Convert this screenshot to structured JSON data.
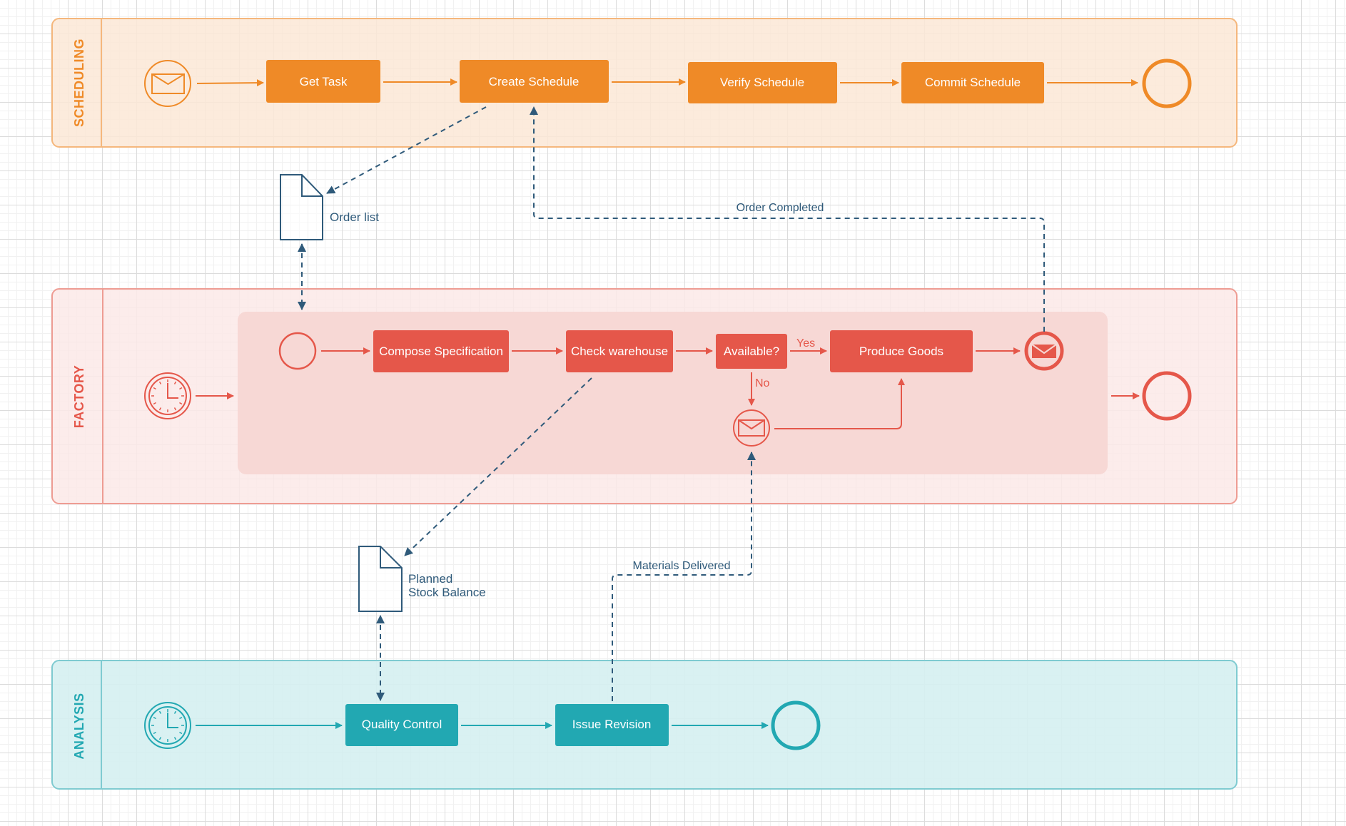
{
  "colors": {
    "scheduling": "#ef8a27",
    "scheduling_fill": "#fbe8d6",
    "scheduling_border": "#f5b77c",
    "factory": "#e5574a",
    "factory_fill": "#fbe9e7",
    "factory_subprocess_fill": "#f7d8d5",
    "factory_border": "#ee9c93",
    "analysis": "#22a8b2",
    "analysis_fill": "#d5f0f1",
    "analysis_border": "#7fcbd1",
    "association": "#2f5a7a"
  },
  "lanes": {
    "scheduling": {
      "title": "SCHEDULING",
      "start_event": "message-start-event",
      "tasks": [
        "Get Task",
        "Create Schedule",
        "Verify Schedule",
        "Commit Schedule"
      ],
      "end_event": "end-event"
    },
    "factory": {
      "title": "FACTORY",
      "start_event": "timer-start-event",
      "subprocess": {
        "start_event": "start-event",
        "tasks": [
          "Compose Specification",
          "Check warehouse",
          "Produce Goods"
        ],
        "gateway_label": "Available?",
        "yes_label": "Yes",
        "no_label": "No",
        "catch_event": "message-intermediate-event",
        "end_event": "message-end-event"
      },
      "end_event": "end-event"
    },
    "analysis": {
      "title": "ANALYSIS",
      "start_event": "timer-start-event",
      "tasks": [
        "Quality Control",
        "Issue Revision"
      ],
      "end_event": "end-event"
    }
  },
  "data_objects": {
    "order_list": "Order list",
    "planned_stock_line1": "Planned",
    "planned_stock_line2": "Stock Balance"
  },
  "message_flows": {
    "order_completed": "Order Completed",
    "materials_delivered": "Materials Delivered"
  }
}
